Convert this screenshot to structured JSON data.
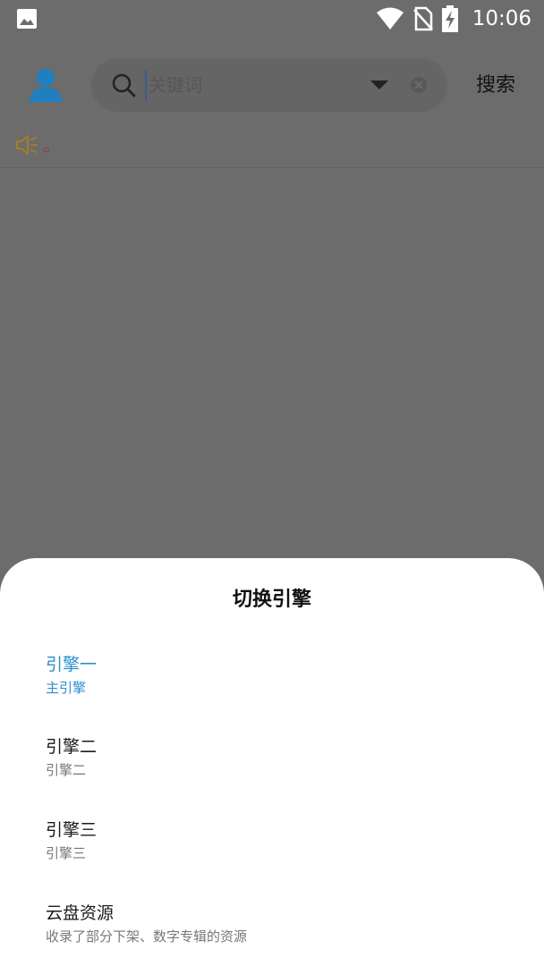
{
  "status_bar": {
    "time": "10:06",
    "icons": [
      "image-icon",
      "wifi-icon",
      "no-sim-icon",
      "battery-charging-icon"
    ]
  },
  "search": {
    "placeholder": "关键词",
    "value": "",
    "button_label": "搜索"
  },
  "notice": {
    "text": "。"
  },
  "sheet": {
    "title": "切换引擎",
    "engines": [
      {
        "name": "引擎一",
        "desc": "主引擎",
        "selected": true
      },
      {
        "name": "引擎二",
        "desc": "引擎二",
        "selected": false
      },
      {
        "name": "引擎三",
        "desc": "引擎三",
        "selected": false
      },
      {
        "name": "云盘资源",
        "desc": "收录了部分下架、数字专辑的资源",
        "selected": false
      }
    ]
  },
  "colors": {
    "accent": "#2b8fd0",
    "avatar": "#1f7fbf",
    "scrim": "#6c6c6c",
    "notice_icon": "#a77a2a"
  }
}
